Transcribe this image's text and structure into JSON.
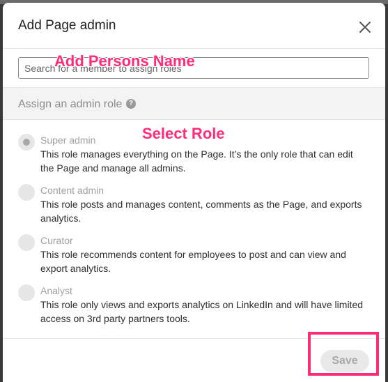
{
  "dialog": {
    "title": "Add Page admin",
    "close_icon": "close-icon"
  },
  "search": {
    "placeholder": "Search for a member to assign roles"
  },
  "section": {
    "label": "Assign an admin role",
    "help_icon": "?"
  },
  "roles": [
    {
      "name": "Super admin",
      "description": "This role manages everything on the Page. It’s the only role that can edit the Page and manage all admins.",
      "selected": true
    },
    {
      "name": "Content admin",
      "description": "This role posts and manages content, comments as the Page, and exports analytics.",
      "selected": false
    },
    {
      "name": "Curator",
      "description": "This role recommends content for employees to post and can view and export analytics.",
      "selected": false
    },
    {
      "name": "Analyst",
      "description": "This role only views and exports analytics on LinkedIn and will have limited access on 3rd party partners tools.",
      "selected": false
    }
  ],
  "footer": {
    "save_label": "Save"
  },
  "annotations": {
    "name_hint": "Add Persons Name",
    "role_hint": "Select Role",
    "highlight_color": "#ff2d78"
  }
}
